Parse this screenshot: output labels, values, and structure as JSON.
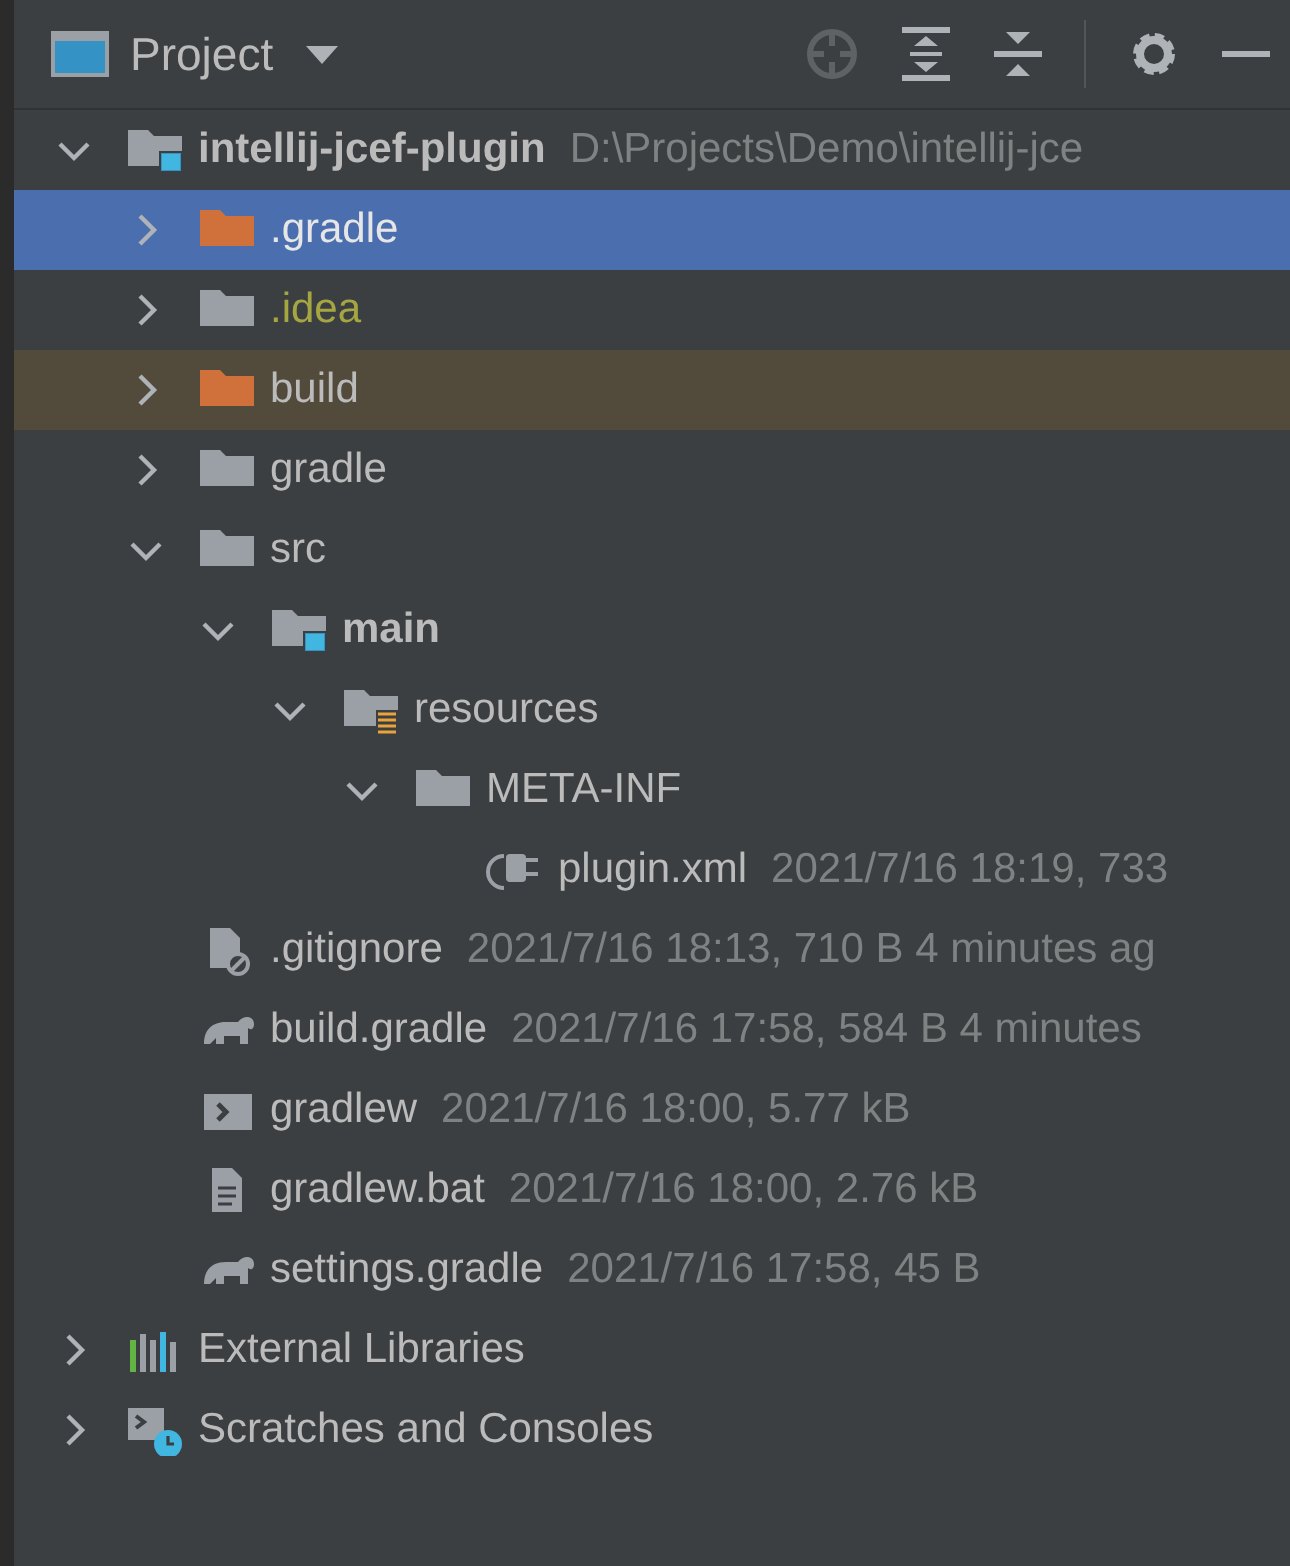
{
  "header": {
    "title": "Project"
  },
  "tree": [
    {
      "name": "intellij-jcef-plugin",
      "meta": "D:\\Projects\\Demo\\intellij-jce",
      "kind": "module",
      "expanded": true,
      "selected": false,
      "highlighted": false,
      "ignored": false,
      "children": [
        {
          "name": ".gradle",
          "kind": "excluded-folder",
          "expanded": false,
          "selected": true,
          "highlighted": false,
          "ignored": false
        },
        {
          "name": ".idea",
          "kind": "folder",
          "expanded": false,
          "selected": false,
          "highlighted": false,
          "ignored": true
        },
        {
          "name": "build",
          "kind": "excluded-folder",
          "expanded": false,
          "selected": false,
          "highlighted": true,
          "ignored": false
        },
        {
          "name": "gradle",
          "kind": "folder",
          "expanded": false,
          "selected": false,
          "highlighted": false,
          "ignored": false
        },
        {
          "name": "src",
          "kind": "folder",
          "expanded": true,
          "selected": false,
          "highlighted": false,
          "ignored": false,
          "children": [
            {
              "name": "main",
              "kind": "module",
              "expanded": true,
              "selected": false,
              "highlighted": false,
              "ignored": false,
              "children": [
                {
                  "name": "resources",
                  "kind": "resources-folder",
                  "expanded": true,
                  "selected": false,
                  "highlighted": false,
                  "ignored": false,
                  "children": [
                    {
                      "name": "META-INF",
                      "kind": "folder",
                      "expanded": true,
                      "selected": false,
                      "highlighted": false,
                      "ignored": false,
                      "children": [
                        {
                          "name": "plugin.xml",
                          "meta": "2021/7/16 18:19, 733",
                          "kind": "plugin-file",
                          "selected": false,
                          "highlighted": false,
                          "ignored": false
                        }
                      ]
                    }
                  ]
                }
              ]
            }
          ]
        },
        {
          "name": ".gitignore",
          "meta": "2021/7/16 18:13, 710 B 4 minutes ag",
          "kind": "ignore-file",
          "selected": false,
          "highlighted": false,
          "ignored": false
        },
        {
          "name": "build.gradle",
          "meta": "2021/7/16 17:58, 584 B 4 minutes",
          "kind": "gradle-file",
          "selected": false,
          "highlighted": false,
          "ignored": false
        },
        {
          "name": "gradlew",
          "meta": "2021/7/16 18:00, 5.77 kB",
          "kind": "shell-file",
          "selected": false,
          "highlighted": false,
          "ignored": false
        },
        {
          "name": "gradlew.bat",
          "meta": "2021/7/16 18:00, 2.76 kB",
          "kind": "text-file",
          "selected": false,
          "highlighted": false,
          "ignored": false
        },
        {
          "name": "settings.gradle",
          "meta": "2021/7/16 17:58, 45 B",
          "kind": "gradle-file",
          "selected": false,
          "highlighted": false,
          "ignored": false
        }
      ]
    },
    {
      "name": "External Libraries",
      "kind": "libraries",
      "expanded": false,
      "selected": false,
      "highlighted": false,
      "ignored": false
    },
    {
      "name": "Scratches and Consoles",
      "kind": "scratches",
      "expanded": false,
      "selected": false,
      "highlighted": false,
      "ignored": false
    }
  ]
}
